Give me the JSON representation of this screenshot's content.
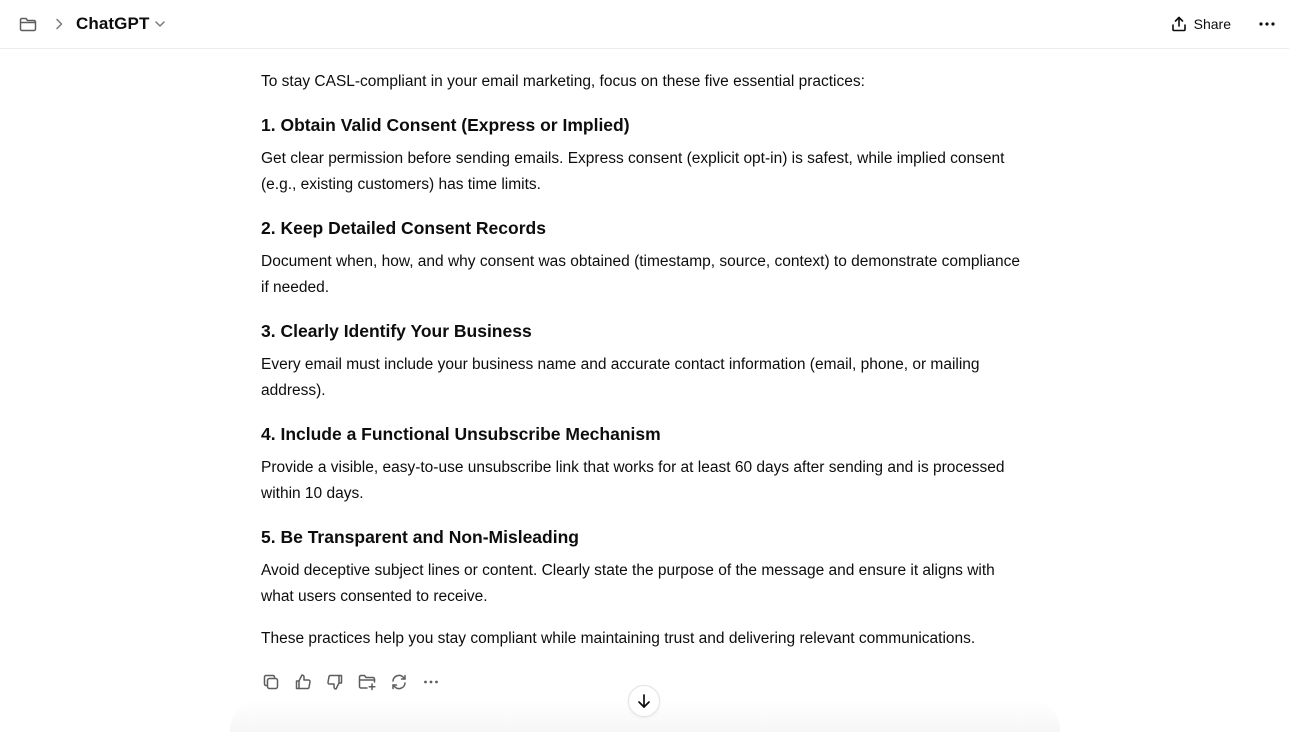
{
  "header": {
    "title": "ChatGPT",
    "share_label": "Share"
  },
  "message": {
    "intro": "To stay CASL-compliant in your email marketing, focus on these five essential practices:",
    "sections": [
      {
        "heading": "1. Obtain Valid Consent (Express or Implied)",
        "body": "Get clear permission before sending emails. Express consent (explicit opt-in) is safest, while implied consent (e.g., existing customers) has time limits."
      },
      {
        "heading": "2. Keep Detailed Consent Records",
        "body": "Document when, how, and why consent was obtained (timestamp, source, context) to demonstrate compliance if needed."
      },
      {
        "heading": "3. Clearly Identify Your Business",
        "body": "Every email must include your business name and accurate contact information (email, phone, or mailing address)."
      },
      {
        "heading": "4. Include a Functional Unsubscribe Mechanism",
        "body": "Provide a visible, easy-to-use unsubscribe link that works for at least 60 days after sending and is processed within 10 days."
      },
      {
        "heading": "5. Be Transparent and Non-Misleading",
        "body": "Avoid deceptive subject lines or content. Clearly state the purpose of the message and ensure it aligns with what users consented to receive."
      }
    ],
    "closing": "These practices help you stay compliant while maintaining trust and delivering relevant communications."
  },
  "actions": {
    "icons": [
      "copy-icon",
      "thumbs-up-icon",
      "thumbs-down-icon",
      "folder-add-icon",
      "regenerate-icon",
      "more-icon"
    ]
  },
  "colors": {
    "text": "#0d0d0d",
    "icon": "#5d5d5d",
    "border": "#ececec"
  }
}
